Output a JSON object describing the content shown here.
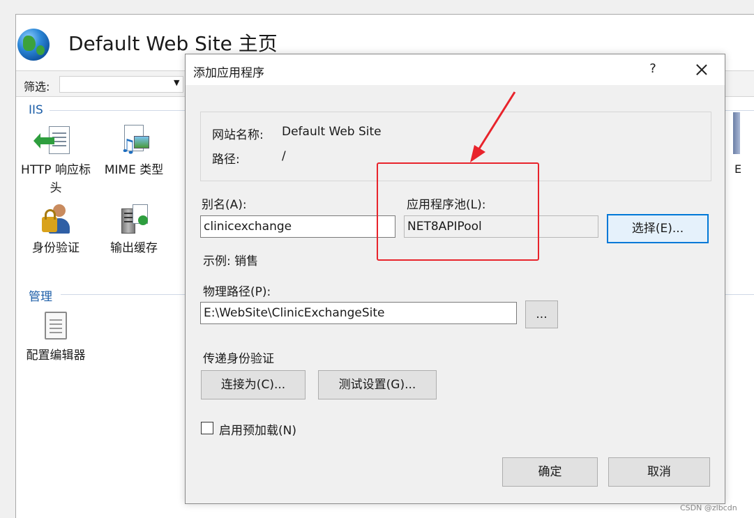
{
  "iis": {
    "site_title": "Default Web Site 主页",
    "filter_label": "筛选:",
    "groups": [
      {
        "title": "IIS"
      },
      {
        "title": "管理"
      }
    ],
    "features": [
      {
        "label": "HTTP 响应标头",
        "icon": "http-response-headers-icon"
      },
      {
        "label": "MIME 类型",
        "icon": "mime-types-icon"
      },
      {
        "label": "身份验证",
        "icon": "authentication-icon"
      },
      {
        "label": "输出缓存",
        "icon": "output-caching-icon"
      },
      {
        "label": "配置编辑器",
        "icon": "configuration-editor-icon"
      }
    ],
    "right_edge_text": "E"
  },
  "dialog": {
    "title": "添加应用程序",
    "help": "?",
    "site_name_label": "网站名称:",
    "site_name_value": "Default Web Site",
    "path_label": "路径:",
    "path_value": "/",
    "alias_label": "别名(A):",
    "alias_value": "clinicexchange",
    "example_text": "示例: 销售",
    "app_pool_label": "应用程序池(L):",
    "app_pool_value": "NET8APIPool",
    "select_button": "选择(E)...",
    "physical_path_label": "物理路径(P):",
    "physical_path_value": "E:\\WebSite\\ClinicExchangeSite",
    "browse_button": "...",
    "pass_through_label": "传递身份验证",
    "connect_as_button": "连接为(C)...",
    "test_settings_button": "测试设置(G)...",
    "enable_preload_label": "启用预加载(N)",
    "enable_preload_checked": false,
    "ok_button": "确定",
    "cancel_button": "取消"
  },
  "annotation": {
    "color": "#e8232b"
  },
  "watermark": "CSDN @zlbcdn"
}
